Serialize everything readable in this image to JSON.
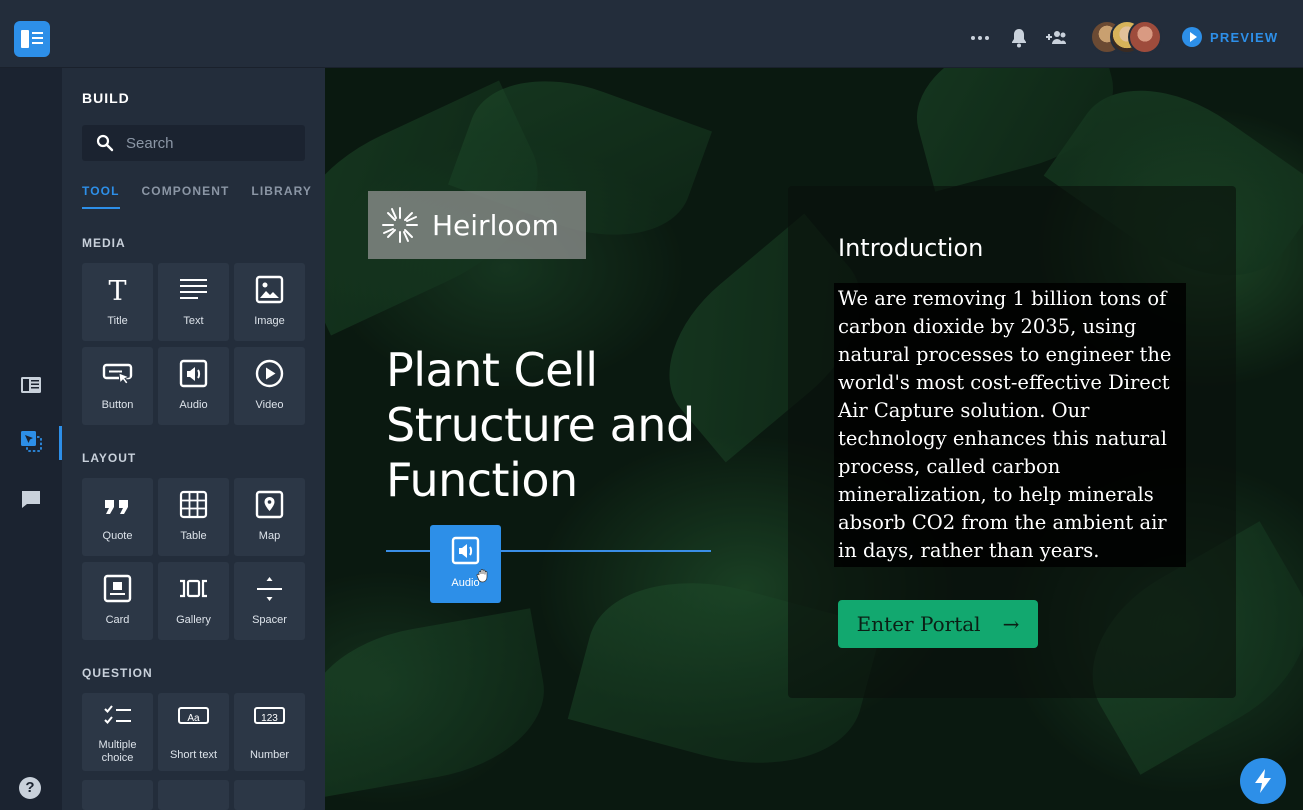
{
  "topbar": {
    "icons": [
      "more-icon",
      "bell-icon",
      "add-people-icon"
    ],
    "preview_label": "PREVIEW"
  },
  "rail": {
    "icons": [
      "pages-icon",
      "build-icon",
      "comments-icon",
      "help-icon"
    ],
    "help_label": "?"
  },
  "panel": {
    "title": "BUILD",
    "search_placeholder": "Search",
    "tabs": [
      {
        "label": "TOOL",
        "active": true
      },
      {
        "label": "COMPONENT",
        "active": false
      },
      {
        "label": "LIBRARY",
        "active": false
      }
    ],
    "sections": {
      "media": {
        "label": "MEDIA",
        "tiles": [
          {
            "label": "Title",
            "icon": "title-icon"
          },
          {
            "label": "Text",
            "icon": "text-icon"
          },
          {
            "label": "Image",
            "icon": "image-icon"
          },
          {
            "label": "Button",
            "icon": "button-icon"
          },
          {
            "label": "Audio",
            "icon": "audio-icon"
          },
          {
            "label": "Video",
            "icon": "video-icon"
          }
        ]
      },
      "layout": {
        "label": "LAYOUT",
        "tiles": [
          {
            "label": "Quote",
            "icon": "quote-icon"
          },
          {
            "label": "Table",
            "icon": "table-icon"
          },
          {
            "label": "Map",
            "icon": "map-icon"
          },
          {
            "label": "Card",
            "icon": "card-icon"
          },
          {
            "label": "Gallery",
            "icon": "gallery-icon"
          },
          {
            "label": "Spacer",
            "icon": "spacer-icon"
          }
        ]
      },
      "question": {
        "label": "QUESTION",
        "tiles": [
          {
            "label": "Multiple choice",
            "icon": "multiple-choice-icon"
          },
          {
            "label": "Short text",
            "icon": "short-text-icon",
            "glyph": "Aa"
          },
          {
            "label": "Number",
            "icon": "number-icon",
            "glyph": "123"
          }
        ]
      }
    }
  },
  "canvas": {
    "logo_text": "Heirloom",
    "hero_title": "Plant Cell Structure and Function",
    "dragging_tile_label": "Audio",
    "intro": {
      "heading": "Introduction",
      "body": "We are removing 1 billion tons of carbon dioxide by 2035, using natural processes to engineer the world's most cost-effective Direct Air Capture solution. Our technology enhances this natural process, called carbon mineralization, to help minerals absorb CO2 from the ambient air in days, rather than years.",
      "button_label": "Enter Portal",
      "button_arrow": "→"
    }
  },
  "colors": {
    "accent": "#2d8fe8",
    "button_green": "#12a86f",
    "panel_bg": "#232d3b",
    "tile_bg": "#2c3746"
  }
}
